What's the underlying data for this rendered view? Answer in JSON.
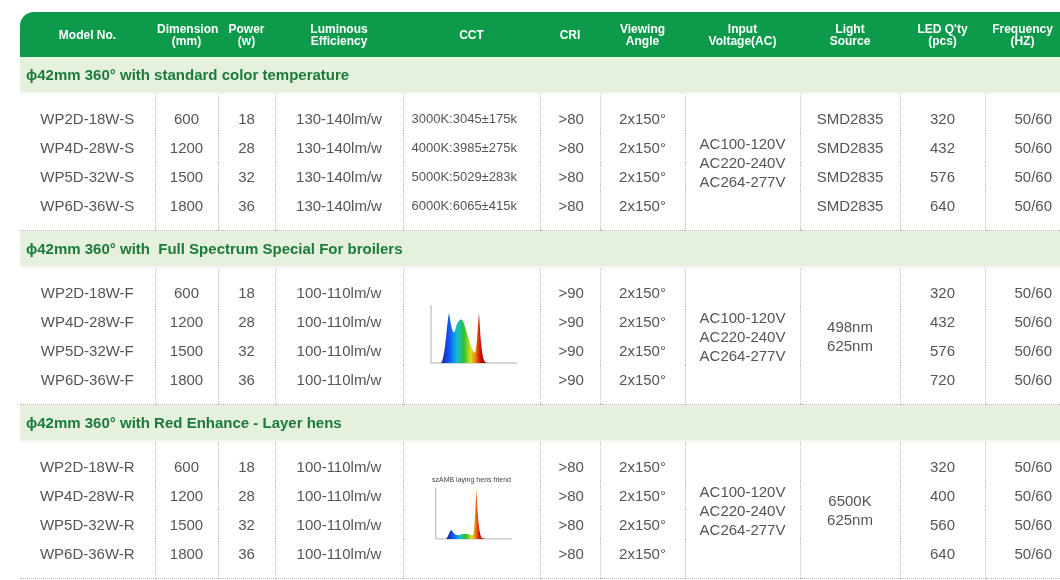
{
  "columns": [
    [
      "Model No."
    ],
    [
      "Dimension",
      "(mm)"
    ],
    [
      "Power",
      "(w)"
    ],
    [
      "Luminous",
      "Efficiency"
    ],
    [
      "CCT"
    ],
    [
      "CRI"
    ],
    [
      "Viewing",
      "Angle"
    ],
    [
      "Input",
      "Voltage(AC)"
    ],
    [
      "Light",
      "Source"
    ],
    [
      "LED Q'ty",
      "(pcs)"
    ],
    [
      "Frequency",
      "(HZ)"
    ]
  ],
  "sections": [
    {
      "kind": "standard",
      "title": "ϕ42mm 360° with standard color temperature",
      "input_voltage": [
        "AC100-120V",
        "AC220-240V",
        "AC264-277V"
      ],
      "rows": [
        {
          "model": "WP2D-18W-S",
          "dimension": "600",
          "power": "18",
          "efficiency": "130-140lm/w",
          "cct": "3000K:3045±175k",
          "cri": ">80",
          "viewing_angle": "2x150°",
          "light_source": "SMD2835",
          "led_qty": "320",
          "frequency": "50/60"
        },
        {
          "model": "WP4D-28W-S",
          "dimension": "1200",
          "power": "28",
          "efficiency": "130-140lm/w",
          "cct": "4000K:3985±275k",
          "cri": ">80",
          "viewing_angle": "2x150°",
          "light_source": "SMD2835",
          "led_qty": "432",
          "frequency": "50/60"
        },
        {
          "model": "WP5D-32W-S",
          "dimension": "1500",
          "power": "32",
          "efficiency": "130-140lm/w",
          "cct": "5000K:5029±283k",
          "cri": ">80",
          "viewing_angle": "2x150°",
          "light_source": "SMD2835",
          "led_qty": "576",
          "frequency": "50/60"
        },
        {
          "model": "WP6D-36W-S",
          "dimension": "1800",
          "power": "36",
          "efficiency": "130-140lm/w",
          "cct": "6000K:6065±415k",
          "cri": ">80",
          "viewing_angle": "2x150°",
          "light_source": "SMD2835",
          "led_qty": "640",
          "frequency": "50/60"
        }
      ]
    },
    {
      "kind": "spectrum",
      "title": "ϕ42mm 360° with  Full Spectrum Special For broilers",
      "spectrum": {
        "kind": "full"
      },
      "input_voltage": [
        "AC100-120V",
        "AC220-240V",
        "AC264-277V"
      ],
      "light_source": [
        "498nm",
        "625nm"
      ],
      "rows": [
        {
          "model": "WP2D-18W-F",
          "dimension": "600",
          "power": "18",
          "efficiency": "100-110lm/w",
          "cri": ">90",
          "viewing_angle": "2x150°",
          "led_qty": "320",
          "frequency": "50/60"
        },
        {
          "model": "WP4D-28W-F",
          "dimension": "1200",
          "power": "28",
          "efficiency": "100-110lm/w",
          "cri": ">90",
          "viewing_angle": "2x150°",
          "led_qty": "432",
          "frequency": "50/60"
        },
        {
          "model": "WP5D-32W-F",
          "dimension": "1500",
          "power": "32",
          "efficiency": "100-110lm/w",
          "cri": ">90",
          "viewing_angle": "2x150°",
          "led_qty": "576",
          "frequency": "50/60"
        },
        {
          "model": "WP6D-36W-F",
          "dimension": "1800",
          "power": "36",
          "efficiency": "100-110lm/w",
          "cri": ">90",
          "viewing_angle": "2x150°",
          "led_qty": "720",
          "frequency": "50/60"
        }
      ]
    },
    {
      "kind": "spectrum",
      "title": "ϕ42mm 360° with Red Enhance - Layer hens",
      "spectrum": {
        "kind": "red",
        "title": "szAMB laying hens friend"
      },
      "input_voltage": [
        "AC100-120V",
        "AC220-240V",
        "AC264-277V"
      ],
      "light_source": [
        "6500K",
        "625nm"
      ],
      "rows": [
        {
          "model": "WP2D-18W-R",
          "dimension": "600",
          "power": "18",
          "efficiency": "100-110lm/w",
          "cri": ">80",
          "viewing_angle": "2x150°",
          "led_qty": "320",
          "frequency": "50/60"
        },
        {
          "model": "WP4D-28W-R",
          "dimension": "1200",
          "power": "28",
          "efficiency": "100-110lm/w",
          "cri": ">80",
          "viewing_angle": "2x150°",
          "led_qty": "400",
          "frequency": "50/60"
        },
        {
          "model": "WP5D-32W-R",
          "dimension": "1500",
          "power": "32",
          "efficiency": "100-110lm/w",
          "cri": ">80",
          "viewing_angle": "2x150°",
          "led_qty": "560",
          "frequency": "50/60"
        },
        {
          "model": "WP6D-36W-R",
          "dimension": "1800",
          "power": "36",
          "efficiency": "100-110lm/w",
          "cri": ">80",
          "viewing_angle": "2x150°",
          "led_qty": "640",
          "frequency": "50/60"
        }
      ]
    }
  ]
}
